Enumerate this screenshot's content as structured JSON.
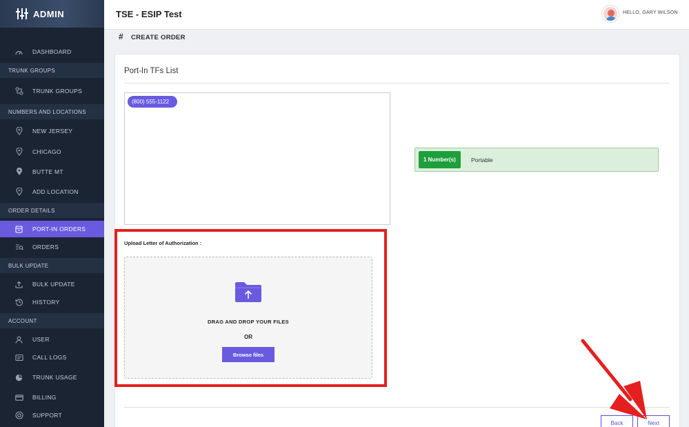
{
  "app": {
    "brand": "ADMIN"
  },
  "header": {
    "title": "TSE - ESIP Test",
    "greeting": "HELLO, GARY WILSON"
  },
  "sidebar": {
    "items": [
      {
        "label": "DASHBOARD",
        "icon": "dashboard-icon"
      },
      {
        "section": "TRUNK GROUPS"
      },
      {
        "label": "TRUNK GROUPS",
        "icon": "trunk-groups-icon"
      },
      {
        "section": "NUMBERS AND LOCATIONS"
      },
      {
        "label": "NEW JERSEY",
        "icon": "location-pin-icon"
      },
      {
        "label": "CHICAGO",
        "icon": "location-pin-icon"
      },
      {
        "label": "BUTTE MT",
        "icon": "location-pin-icon"
      },
      {
        "label": "ADD LOCATION",
        "icon": "add-location-icon"
      },
      {
        "section": "ORDER DETAILS"
      },
      {
        "label": "PORT-IN ORDERS",
        "icon": "port-in-icon",
        "active": true
      },
      {
        "label": "ORDERS",
        "icon": "orders-icon"
      },
      {
        "section": "BULK UPDATE"
      },
      {
        "label": "BULK UPDATE",
        "icon": "upload-icon"
      },
      {
        "label": "HISTORY",
        "icon": "history-icon"
      },
      {
        "section": "ACCOUNT"
      },
      {
        "label": "USER",
        "icon": "user-icon"
      },
      {
        "label": "CALL LOGS",
        "icon": "call-logs-icon"
      },
      {
        "label": "TRUNK USAGE",
        "icon": "pie-chart-icon"
      },
      {
        "label": "BILLING",
        "icon": "billing-icon"
      },
      {
        "label": "SUPPORT",
        "icon": "support-icon"
      }
    ]
  },
  "page": {
    "title": "CREATE ORDER"
  },
  "card": {
    "title": "Port-In TFs List",
    "numbers": [
      "(800) 555-1122"
    ],
    "status": {
      "badge": "1 Number(s)",
      "text": "Portable"
    },
    "upload": {
      "label": "Upload Letter of Authorization :",
      "drag_text": "DRAG AND DROP YOUR FILES",
      "or_text": "OR",
      "browse_label": "Browse files"
    },
    "buttons": {
      "back": "Back",
      "next": "Next"
    }
  },
  "colors": {
    "accent": "#6a5ae0",
    "success": "#1f9e3c",
    "highlight": "#e51f1f",
    "sidebar": "#1b2433"
  }
}
